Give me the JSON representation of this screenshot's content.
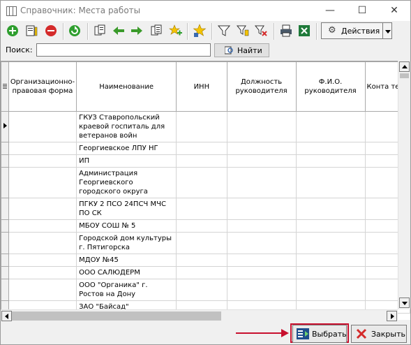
{
  "window": {
    "title": "Справочник: Места работы"
  },
  "toolbar": {
    "actions_label": "Действия"
  },
  "search": {
    "label": "Поиск:",
    "value": "",
    "find_label": "Найти"
  },
  "grid": {
    "columns": [
      "Организационно-правовая форма",
      "Наименование",
      "ИНН",
      "Должность руководителя",
      "Ф.И.О. руководителя",
      "Конта теле"
    ],
    "rows": [
      {
        "form": "",
        "name": "ГКУЗ Ставропольский краевой госпиталь для ветеранов войн"
      },
      {
        "form": "",
        "name": "Георгиевское ЛПУ НГ"
      },
      {
        "form": "",
        "name": "ИП"
      },
      {
        "form": "",
        "name": "Администрация Георгиевского городского округа"
      },
      {
        "form": "",
        "name": "ПГКУ 2 ПСО 24ПСЧ МЧС ПО СК"
      },
      {
        "form": "",
        "name": "МБОУ СОШ № 5"
      },
      {
        "form": "",
        "name": "Городской дом культуры г. Пятигорска"
      },
      {
        "form": "",
        "name": "МДОУ №45"
      },
      {
        "form": "",
        "name": "ООО САЛЮДЕРМ"
      },
      {
        "form": "",
        "name": "ООО \"Органика\" г. Ростов на Дону"
      },
      {
        "form": "",
        "name": "ЗАО \"Байсад\""
      }
    ]
  },
  "buttons": {
    "select_label": "Выбрать",
    "close_label": "Закрыть"
  },
  "colors": {
    "highlight": "#c8102e",
    "green": "#2e9e2e",
    "red": "#d42a2a",
    "yellow": "#f5c400"
  }
}
